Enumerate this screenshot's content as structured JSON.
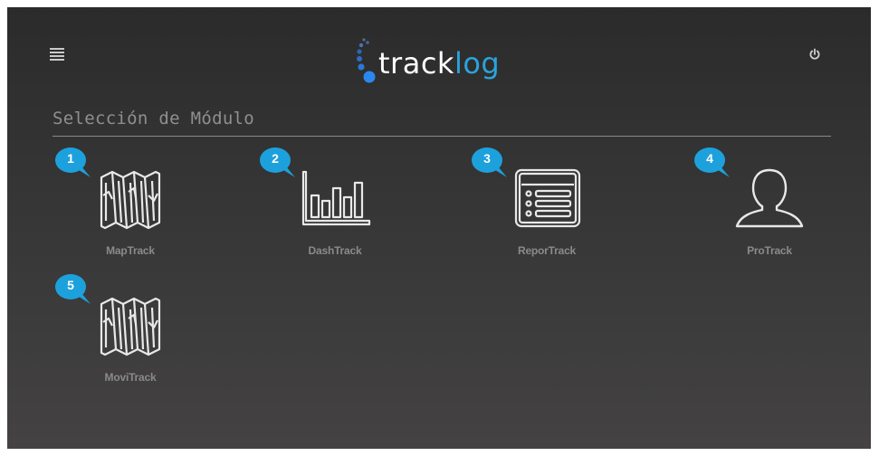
{
  "header": {
    "menu_icon": "hamburger-menu-icon",
    "logout_icon": "power-icon",
    "logo": {
      "part1": "track",
      "part2": "log",
      "color_primary": "#ffffff",
      "color_accent": "#2ba3db"
    }
  },
  "section": {
    "title": "Selección de Módulo"
  },
  "theme": {
    "background_top": "#2b2b2b",
    "background_bottom": "#444242",
    "badge_color": "#1da1dc",
    "icon_color": "#e8e8e8",
    "label_color": "#8a8a8a"
  },
  "modules": [
    {
      "number": "1",
      "label": "MapTrack",
      "icon": "map-icon"
    },
    {
      "number": "2",
      "label": "DashTrack",
      "icon": "bar-chart-icon"
    },
    {
      "number": "3",
      "label": "ReporTrack",
      "icon": "report-list-icon"
    },
    {
      "number": "4",
      "label": "ProTrack",
      "icon": "user-profile-icon"
    },
    {
      "number": "5",
      "label": "MoviTrack",
      "icon": "map-icon"
    }
  ]
}
